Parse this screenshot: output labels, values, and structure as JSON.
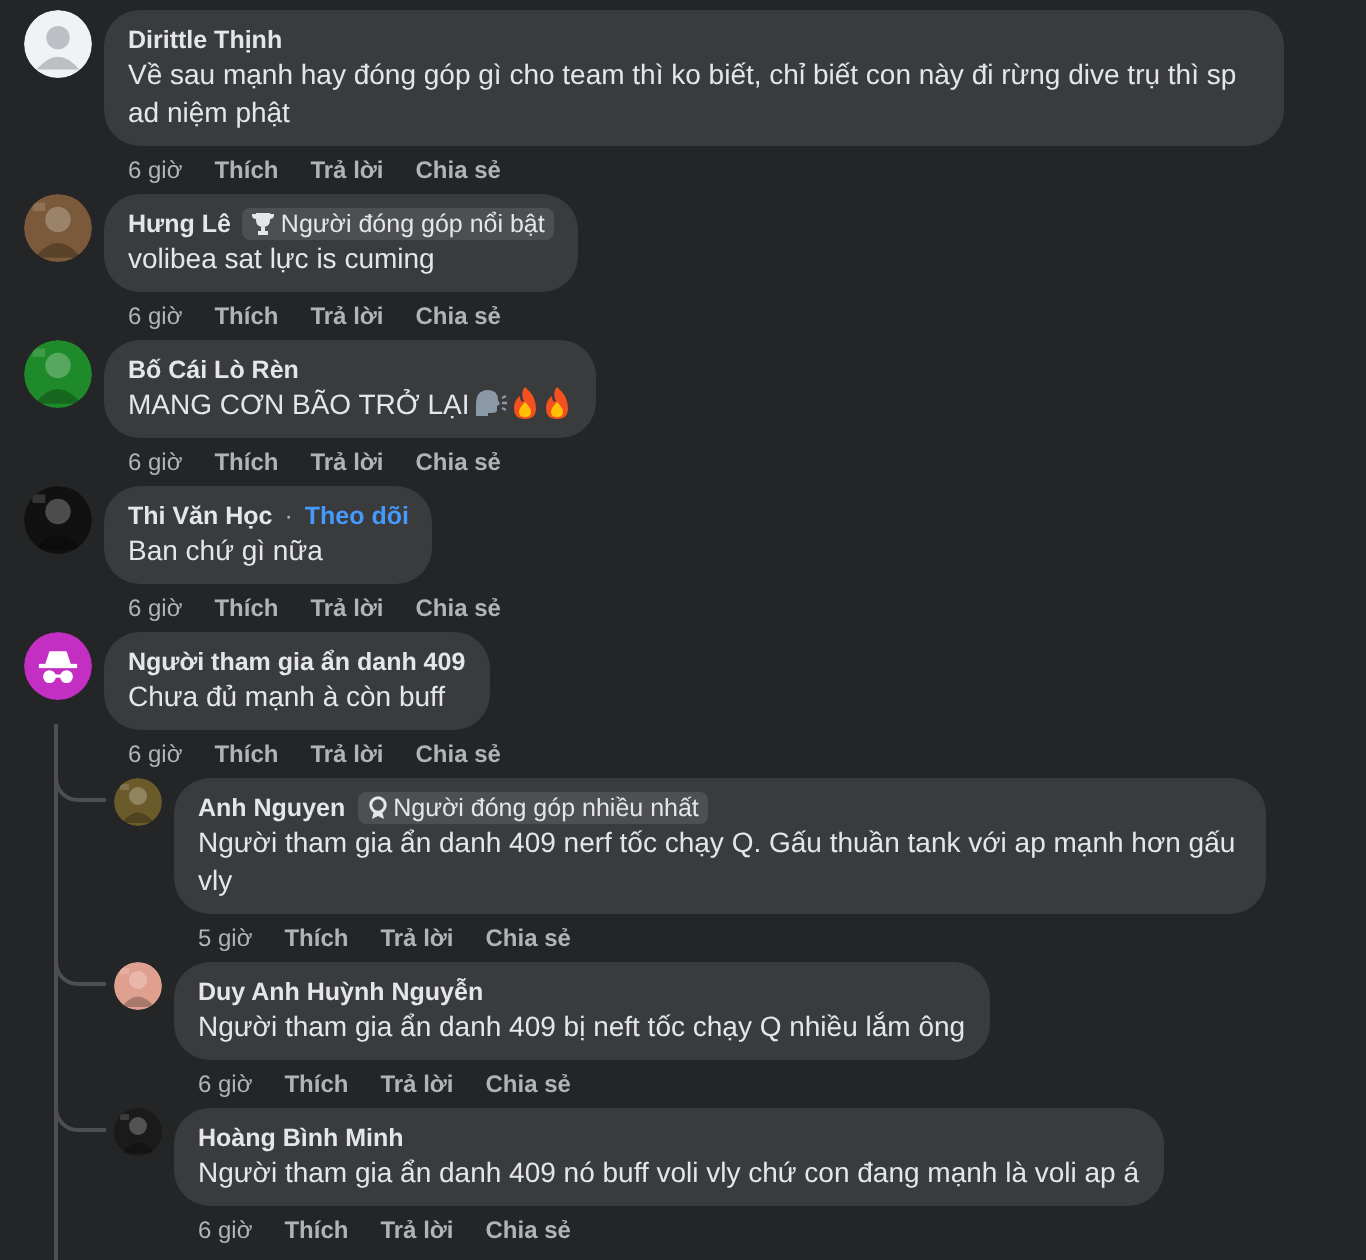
{
  "comments": [
    {
      "author": "Dirittle Thịnh",
      "avatar": {
        "kind": "default"
      },
      "text": "Về sau mạnh hay đóng góp gì cho team thì ko biết, chỉ biết con này đi rừng dive trụ thì sp ad niệm phật",
      "time": "6 giờ",
      "actions": [
        "Thích",
        "Trả lời",
        "Chia sẻ"
      ]
    },
    {
      "author": "Hưng Lê",
      "badge": {
        "kind": "trophy",
        "label": "Người đóng góp nổi bật"
      },
      "text": "volibea sat lực is cuming",
      "time": "6 giờ",
      "actions": [
        "Thích",
        "Trả lời",
        "Chia sẻ"
      ]
    },
    {
      "author": "Bố Cái Lò Rèn",
      "text": "MANG CƠN BÃO TRỞ LẠI",
      "emoji": [
        {
          "kind": "speaking"
        },
        {
          "kind": "fire"
        },
        {
          "kind": "fire"
        }
      ],
      "time": "6 giờ",
      "actions": [
        "Thích",
        "Trả lời",
        "Chia sẻ"
      ]
    },
    {
      "author": "Thi Văn Học",
      "follow": {
        "separator": "·",
        "label": "Theo dõi"
      },
      "text": "Ban chứ gì nữa",
      "time": "6 giờ",
      "actions": [
        "Thích",
        "Trả lời",
        "Chia sẻ"
      ]
    },
    {
      "author": "Người tham gia ẩn danh 409",
      "avatar": {
        "kind": "anonymous"
      },
      "text": "Chưa đủ mạnh à còn buff",
      "time": "6 giờ",
      "actions": [
        "Thích",
        "Trả lời",
        "Chia sẻ"
      ],
      "replies": [
        {
          "author": "Anh Nguyen",
          "badge": {
            "kind": "medal",
            "label": "Người đóng góp nhiều nhất"
          },
          "text": "Người tham gia ẩn danh 409 nerf tốc chạy Q. Gấu thuần tank với ap mạnh hơn gấu vly",
          "time": "5 giờ",
          "actions": [
            "Thích",
            "Trả lời",
            "Chia sẻ"
          ]
        },
        {
          "author": "Duy Anh Huỳnh Nguyễn",
          "text": "Người tham gia ẩn danh 409 bị neft tốc chạy Q nhiều lắm ông",
          "time": "6 giờ",
          "actions": [
            "Thích",
            "Trả lời",
            "Chia sẻ"
          ]
        },
        {
          "author": "Hoàng Bình Minh",
          "text": "Người tham gia ẩn danh 409 nó buff voli vly chứ con đang mạnh là voli ap á",
          "time": "6 giờ",
          "actions": [
            "Thích",
            "Trả lời",
            "Chia sẻ"
          ]
        }
      ]
    }
  ]
}
